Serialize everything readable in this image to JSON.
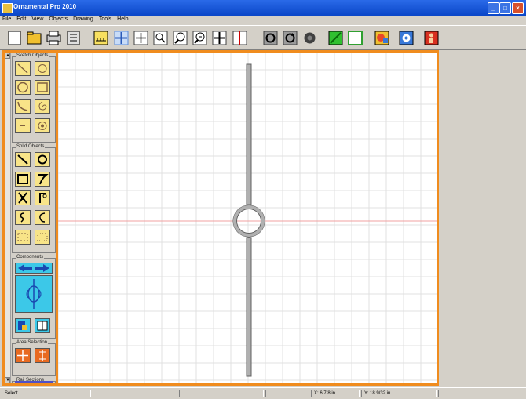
{
  "window": {
    "title": "Ornamental Pro 2010",
    "min": "_",
    "max": "□",
    "close": "×"
  },
  "menu": [
    "File",
    "Edit",
    "View",
    "Objects",
    "Drawing",
    "Tools",
    "Help"
  ],
  "toolbar": {
    "buttons": [
      {
        "name": "new-icon",
        "color": "#ffffff"
      },
      {
        "name": "open-folder-icon",
        "color": "#f0c030"
      },
      {
        "name": "print-icon",
        "color": "#c8c8c8"
      },
      {
        "name": "document-icon",
        "color": "#e0e0e0"
      },
      {
        "name": "measure-icon",
        "color": "#f8e060"
      },
      {
        "name": "snap-grid-icon",
        "color": "#5a8ad8"
      },
      {
        "name": "crosshair-icon",
        "color": "#ffffff"
      },
      {
        "name": "zoom-window-icon",
        "color": "#ffffff"
      },
      {
        "name": "zoom-in-icon",
        "color": "#ffffff"
      },
      {
        "name": "zoom-out-icon",
        "color": "#ffffff"
      },
      {
        "name": "pan-icon",
        "color": "#ffffff"
      },
      {
        "name": "grid-toggle-icon",
        "color": "#ffffff"
      },
      {
        "name": "rotate-left-icon",
        "color": "#707070"
      },
      {
        "name": "rotate-right-icon",
        "color": "#707070"
      },
      {
        "name": "fill-icon",
        "color": "#404040"
      },
      {
        "name": "green-layer-icon",
        "color": "#30c030"
      },
      {
        "name": "white-layer-icon",
        "color": "#ffffff"
      },
      {
        "name": "render-icon",
        "color": "#e84828"
      },
      {
        "name": "settings-gear-icon",
        "color": "#3878d8"
      },
      {
        "name": "exit-icon",
        "color": "#d83020"
      }
    ]
  },
  "palette": {
    "groups": [
      {
        "label": "Sketch Objects"
      },
      {
        "label": "Solid Objects"
      },
      {
        "label": "Components"
      },
      {
        "label": "Area Selection"
      },
      {
        "label": "Rail Sections"
      }
    ],
    "scroll_up": "▲",
    "scroll_down": "▼"
  },
  "canvas": {
    "background": "#ffffff",
    "grid_color": "#e0e0e0",
    "axis_color": "#f0a0a0",
    "shape_color": "#b0b0b0"
  },
  "status": {
    "mode": "Select",
    "x": "X: 6 7/8 in",
    "y": "Y: 18 9/32 in"
  }
}
